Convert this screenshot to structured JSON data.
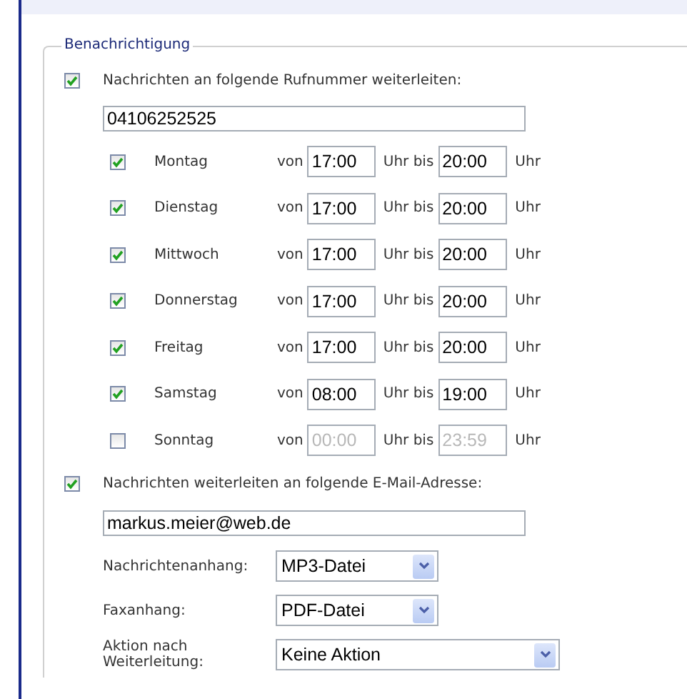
{
  "section": {
    "legend": "Benachrichtigung"
  },
  "phone_forward": {
    "checked": true,
    "label": "Nachrichten an folgende Rufnummer weiterleiten:",
    "value": "04106252525"
  },
  "days": [
    {
      "name": "Montag",
      "checked": true,
      "from_label": "von",
      "from": "17:00",
      "to_label": "Uhr bis",
      "to": "20:00",
      "unit": "Uhr"
    },
    {
      "name": "Dienstag",
      "checked": true,
      "from_label": "von",
      "from": "17:00",
      "to_label": "Uhr bis",
      "to": "20:00",
      "unit": "Uhr"
    },
    {
      "name": "Mittwoch",
      "checked": true,
      "from_label": "von",
      "from": "17:00",
      "to_label": "Uhr bis",
      "to": "20:00",
      "unit": "Uhr"
    },
    {
      "name": "Donnerstag",
      "checked": true,
      "from_label": "von",
      "from": "17:00",
      "to_label": "Uhr bis",
      "to": "20:00",
      "unit": "Uhr"
    },
    {
      "name": "Freitag",
      "checked": true,
      "from_label": "von",
      "from": "17:00",
      "to_label": "Uhr bis",
      "to": "20:00",
      "unit": "Uhr"
    },
    {
      "name": "Samstag",
      "checked": true,
      "from_label": "von",
      "from": "08:00",
      "to_label": "Uhr bis",
      "to": "19:00",
      "unit": "Uhr"
    },
    {
      "name": "Sonntag",
      "checked": false,
      "from_label": "von",
      "from": "00:00",
      "to_label": "Uhr bis",
      "to": "23:59",
      "unit": "Uhr"
    }
  ],
  "email_forward": {
    "checked": true,
    "label": "Nachrichten weiterleiten an folgende E-Mail-Adresse:",
    "value": "markus.meier@web.de"
  },
  "selects": [
    {
      "label": "Nachrichtenanhang:",
      "value": "MP3-Datei",
      "wide": false
    },
    {
      "label": "Faxanhang:",
      "value": "PDF-Datei",
      "wide": false
    },
    {
      "label": "Aktion nach Weiterleitung:",
      "value": "Keine Aktion",
      "wide": true
    }
  ]
}
